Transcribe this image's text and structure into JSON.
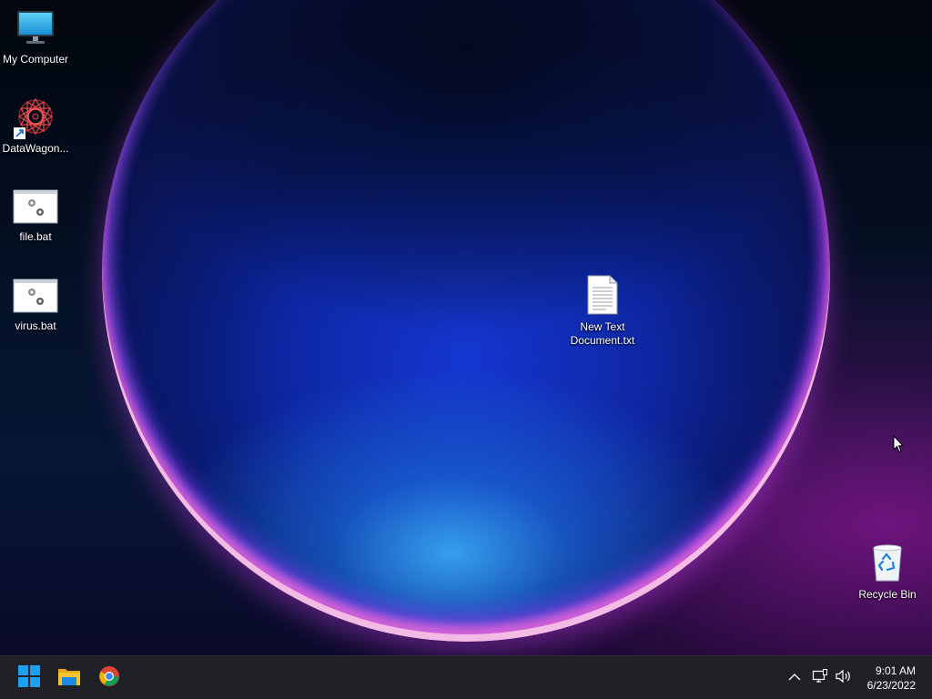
{
  "desktop": {
    "icons": [
      {
        "label": "My Computer",
        "icon": "monitor-icon"
      },
      {
        "label": "DataWagon...",
        "icon": "datawagon-shortcut-icon"
      },
      {
        "label": "file.bat",
        "icon": "batch-file-icon"
      },
      {
        "label": "virus.bat",
        "icon": "batch-file-icon"
      },
      {
        "label_line1": "New Text",
        "label_line2": "Document.txt",
        "icon": "text-document-icon"
      },
      {
        "label": "Recycle Bin",
        "icon": "recycle-bin-icon"
      }
    ]
  },
  "taskbar": {
    "pinned": [
      {
        "name": "Start",
        "icon": "windows-start-icon"
      },
      {
        "name": "File Explorer",
        "icon": "folder-icon"
      },
      {
        "name": "Google Chrome",
        "icon": "chrome-icon"
      }
    ],
    "tray": {
      "icons": [
        "chevron-up-icon",
        "network-icon",
        "volume-icon"
      ]
    },
    "clock": {
      "time": "9:01 AM",
      "date": "6/23/2022"
    }
  },
  "colors": {
    "taskbar_bg": "#1f2126",
    "start_blue": "#1ea0f0",
    "folder_yellow": "#f4c430"
  }
}
